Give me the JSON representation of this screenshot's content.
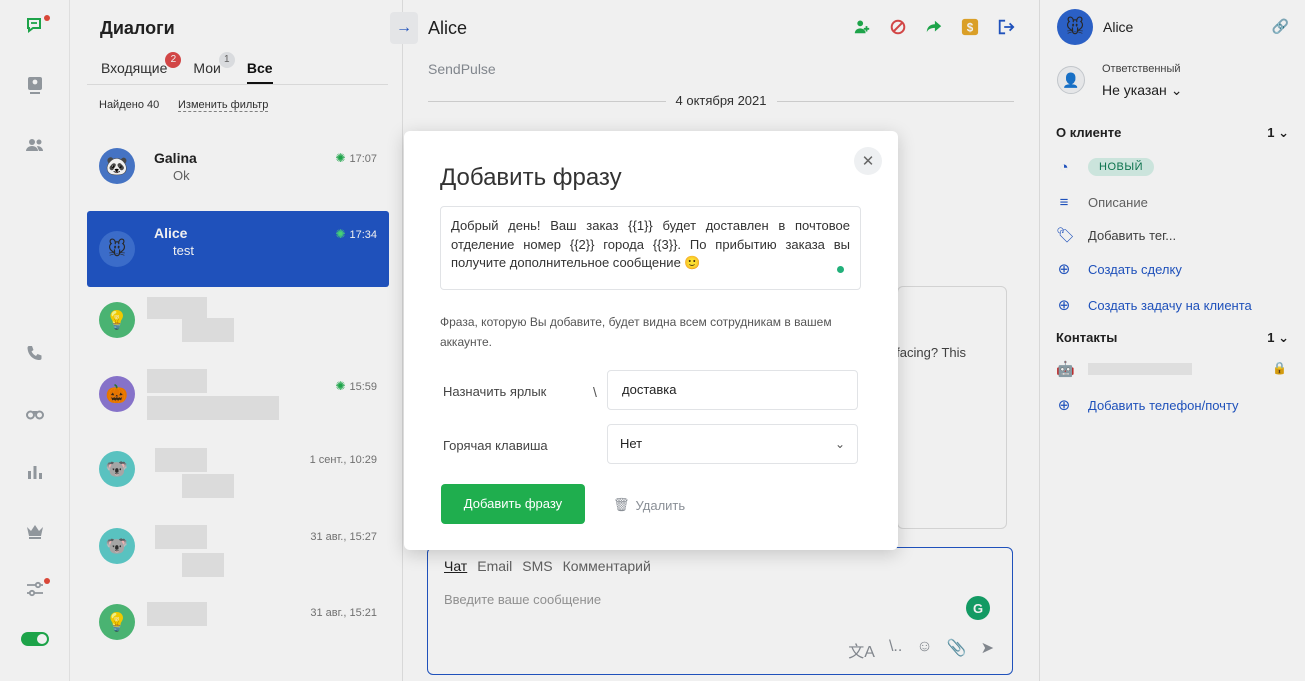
{
  "sidebar": {
    "icons": [
      "chat-icon",
      "contacts-card-icon",
      "users-icon",
      "phone-icon",
      "binoculars-icon",
      "analytics-icon",
      "crown-icon",
      "settings-sliders-icon"
    ]
  },
  "list": {
    "title": "Диалоги",
    "tabs": [
      {
        "label": "Входящие",
        "badge": "2"
      },
      {
        "label": "Мои",
        "badge": "1"
      },
      {
        "label": "Все",
        "badge": ""
      }
    ],
    "found": "Найдено 40",
    "change_filter": "Изменить фильтр",
    "rows": [
      {
        "name": "Galina",
        "message": "Ok",
        "time": "17:07",
        "avatar": "🐼",
        "avatar_bg": "#4a7bd0",
        "bot": true
      },
      {
        "name": "Alice",
        "message": "test",
        "time": "17:34",
        "avatar": "🐭",
        "avatar_bg": "#3f73d6",
        "bot": true
      },
      {
        "name": "",
        "message": "",
        "time": "",
        "avatar": "💡",
        "avatar_bg": "#4fbf7a",
        "bot": false
      },
      {
        "name": "",
        "message": "",
        "time": "15:59",
        "avatar": "🎃",
        "avatar_bg": "#8f7ad6",
        "bot": true
      },
      {
        "name": "",
        "message": "",
        "time": "1 сент., 10:29",
        "avatar": "🐨",
        "avatar_bg": "#5fcfcc",
        "bot": false
      },
      {
        "name": "",
        "message": "",
        "time": "31 авг., 15:27",
        "avatar": "🐨",
        "avatar_bg": "#5fcfcc",
        "bot": false
      },
      {
        "name": "",
        "message": "",
        "time": "31 авг., 15:21",
        "avatar": "💡",
        "avatar_bg": "#4fbf7a",
        "bot": false
      }
    ]
  },
  "chat": {
    "title": "Alice",
    "source": "SendPulse",
    "date": "4 октября 2021",
    "bg_fragment": "re facing? This",
    "composer": {
      "tabs": [
        "Чат",
        "Email",
        "SMS",
        "Комментарий"
      ],
      "placeholder": "Введите ваше сообщение"
    }
  },
  "right": {
    "name": "Alice",
    "responsible_label": "Ответственный",
    "responsible_value": "Не указан",
    "about_title": "О клиенте",
    "about_count": "1",
    "status_chip": "НОВЫЙ",
    "description": "Описание",
    "add_tag": "Добавить тег...",
    "create_deal": "Создать сделку",
    "create_task": "Создать задачу на клиента",
    "contacts_title": "Контакты",
    "contacts_count": "1",
    "add_phone": "Добавить телефон/почту"
  },
  "modal": {
    "title": "Добавить фразу",
    "phrase": "Добрый день! Ваш заказ {{1}} будет доставлен в почтовое отделение номер {{2}} города {{3}}. По прибытию заказа вы получите дополнительное сообщение 🙂",
    "note": "Фраза, которую Вы добавите, будет видна всем сотрудникам в вашем аккаунте.",
    "label_field": "Назначить ярлык",
    "backslash": "\\",
    "label_value": "доставка",
    "hotkey_field": "Горячая клавиша",
    "hotkey_value": "Нет",
    "submit": "Добавить фразу",
    "delete": "Удалить"
  },
  "colors": {
    "accent_blue": "#2157c7",
    "green": "#1fae4e",
    "badge_red": "#e04b4b"
  }
}
